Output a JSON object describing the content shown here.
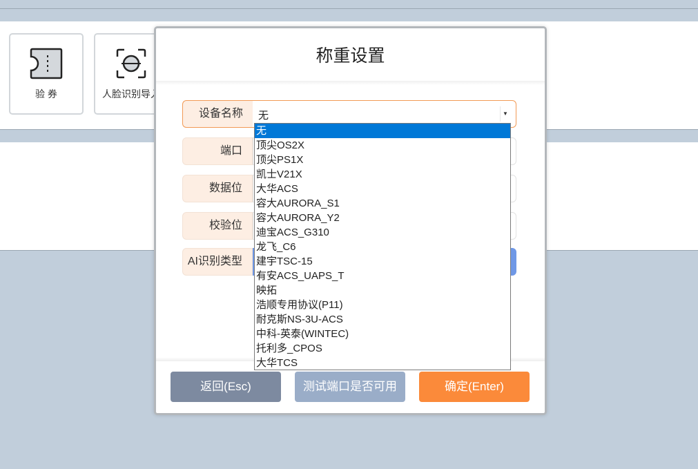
{
  "toolbar": {
    "tiles": [
      {
        "label": "验 券",
        "icon": "ticket-icon"
      },
      {
        "label": "人脸识别导入",
        "icon": "face-scan-icon"
      }
    ]
  },
  "dialog": {
    "title": "称重设置",
    "fields": {
      "device_name": {
        "label": "设备名称",
        "value": "无"
      },
      "port": {
        "label": "端口"
      },
      "data_bits": {
        "label": "数据位"
      },
      "parity": {
        "label": "校验位"
      },
      "ai_type": {
        "label": "AI识别类型"
      }
    },
    "buttons": {
      "back": "返回(Esc)",
      "test_port": "测试端口是否可用",
      "confirm": "确定(Enter)"
    },
    "colors": {
      "accent_orange": "#fb8a3a",
      "selected_blue": "#0078d7"
    }
  },
  "dropdown": {
    "selected": "无",
    "options": [
      "无",
      "顶尖OS2X",
      "顶尖PS1X",
      "凯士V21X",
      "大华ACS",
      "容大AURORA_S1",
      "容大AURORA_Y2",
      "迪宝ACS_G310",
      "龙飞_C6",
      "建宇TSC-15",
      "有安ACS_UAPS_T",
      "映拓",
      "浩顺专用协议(P11)",
      "耐克斯NS-3U-ACS",
      "中科-英泰(WINTEC)",
      "托利多_CPOS",
      "大华TCS"
    ]
  }
}
